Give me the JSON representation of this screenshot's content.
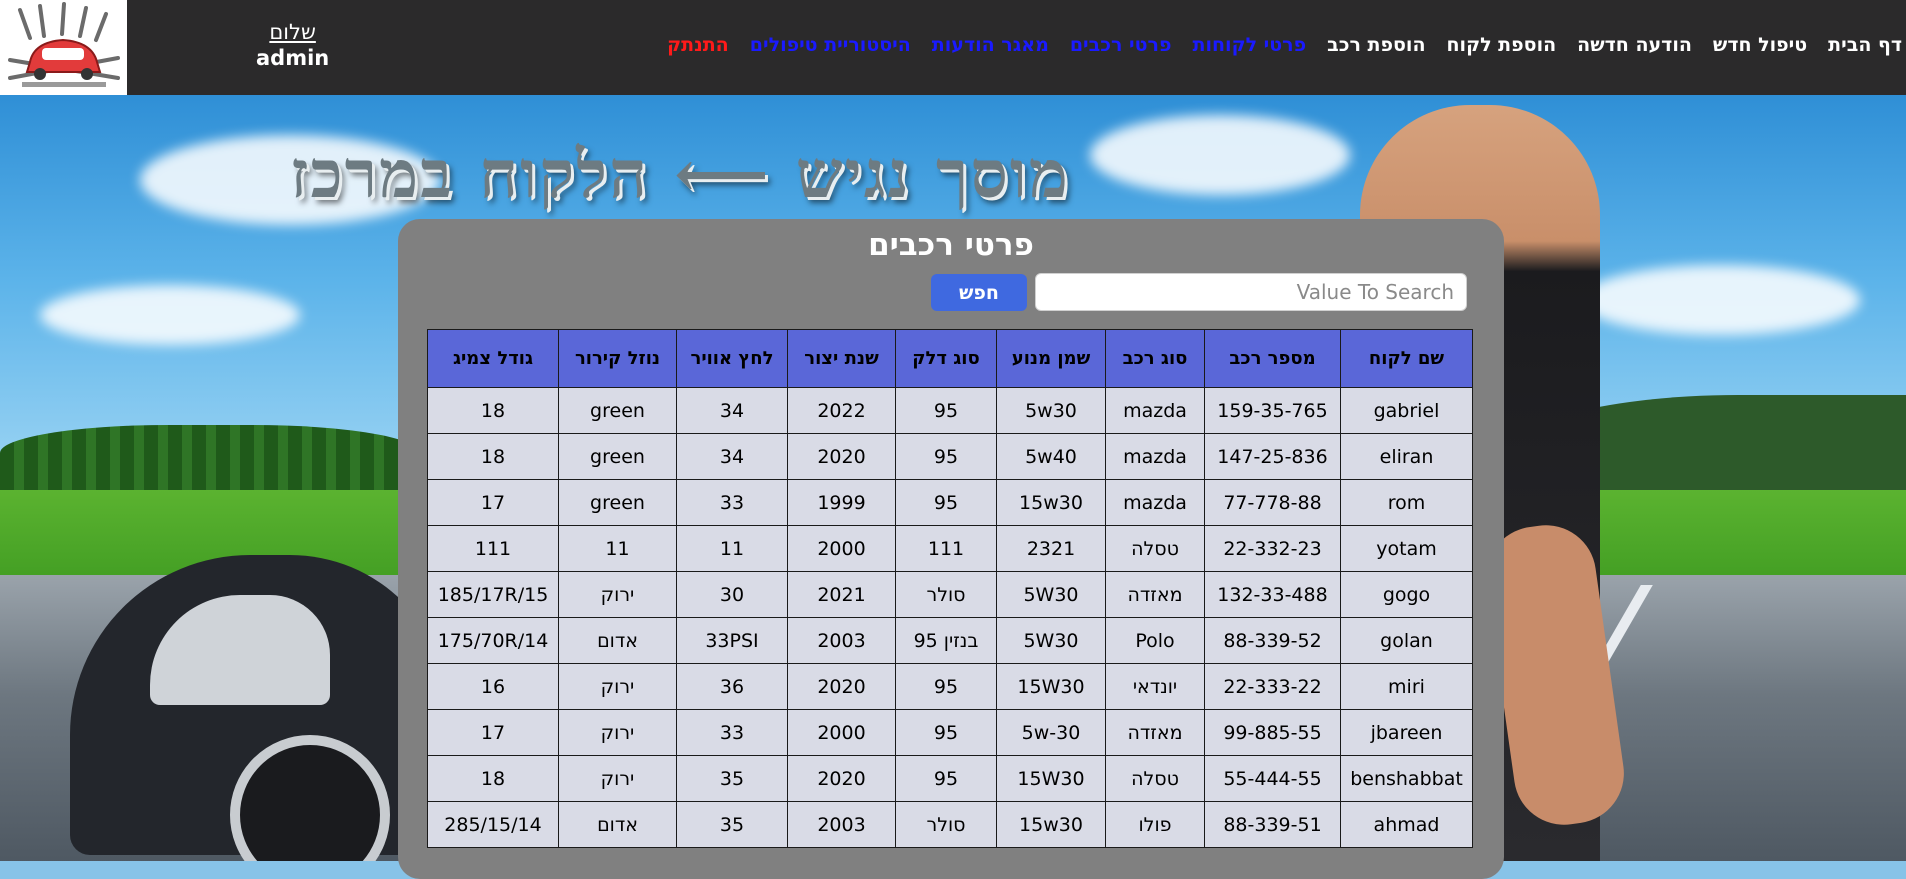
{
  "nav": {
    "items": [
      {
        "label": "דף הבית",
        "style": "white"
      },
      {
        "label": "טיפול חדש",
        "style": "white"
      },
      {
        "label": "הודעה חדשה",
        "style": "white"
      },
      {
        "label": "הוספת לקוח",
        "style": "white"
      },
      {
        "label": "הוספת רכב",
        "style": "white"
      },
      {
        "label": "פרטי לקוחות",
        "style": "blue"
      },
      {
        "label": "פרטי רכבים",
        "style": "blue"
      },
      {
        "label": "מאגר הודעות",
        "style": "blue"
      },
      {
        "label": "היסטוריית טיפולים",
        "style": "blue"
      },
      {
        "label": "התנתק",
        "style": "red"
      }
    ]
  },
  "greeting": {
    "hello": "שלום",
    "user": "admin"
  },
  "banner": {
    "headline": "מוסך נגיש ⟵ הלקוח במרכז"
  },
  "colors": {
    "topbar": "#2b2a2b",
    "panel": "#808080",
    "header": "#5a67d8",
    "cell": "#d9dbe6",
    "button": "#3f69e0"
  },
  "panel": {
    "title": "פרטי רכבים",
    "search_placeholder": "Value To Search",
    "search_button": "חפש"
  },
  "table": {
    "headers": [
      "שם לקוח",
      "מספר רכב",
      "סוג רכב",
      "שמן מנוע",
      "סוג דלק",
      "שנת יצור",
      "לחץ אוויר",
      "נוזל קירור",
      "גודל צמיג"
    ],
    "rows": [
      [
        "gabriel",
        "159-35-765",
        "mazda",
        "5w30",
        "95",
        "2022",
        "34",
        "green",
        "18"
      ],
      [
        "eliran",
        "147-25-836",
        "mazda",
        "5w40",
        "95",
        "2020",
        "34",
        "green",
        "18"
      ],
      [
        "rom",
        "77-778-88",
        "mazda",
        "15w30",
        "95",
        "1999",
        "33",
        "green",
        "17"
      ],
      [
        "yotam",
        "22-332-23",
        "טסלה",
        "2321",
        "111",
        "2000",
        "11",
        "11",
        "111"
      ],
      [
        "gogo",
        "132-33-488",
        "מאזדה",
        "5W30",
        "סולר",
        "2021",
        "30",
        "ירוק",
        "185/17R/15"
      ],
      [
        "golan",
        "88-339-52",
        "Polo",
        "5W30",
        "בנזין 95",
        "2003",
        "33PSI",
        "אדום",
        "175/70R/14"
      ],
      [
        "miri",
        "22-333-22",
        "יונדאי",
        "15W30",
        "95",
        "2020",
        "36",
        "ירוק",
        "16"
      ],
      [
        "jbareen",
        "99-885-55",
        "מאזדה",
        "5w-30",
        "95",
        "2000",
        "33",
        "ירוק",
        "17"
      ],
      [
        "benshabbat",
        "55-444-55",
        "טסלה",
        "15W30",
        "95",
        "2020",
        "35",
        "ירוק",
        "18"
      ],
      [
        "ahmad",
        "88-339-51",
        "פולו",
        "15w30",
        "סולר",
        "2003",
        "35",
        "אדום",
        "285/15/14"
      ]
    ]
  }
}
